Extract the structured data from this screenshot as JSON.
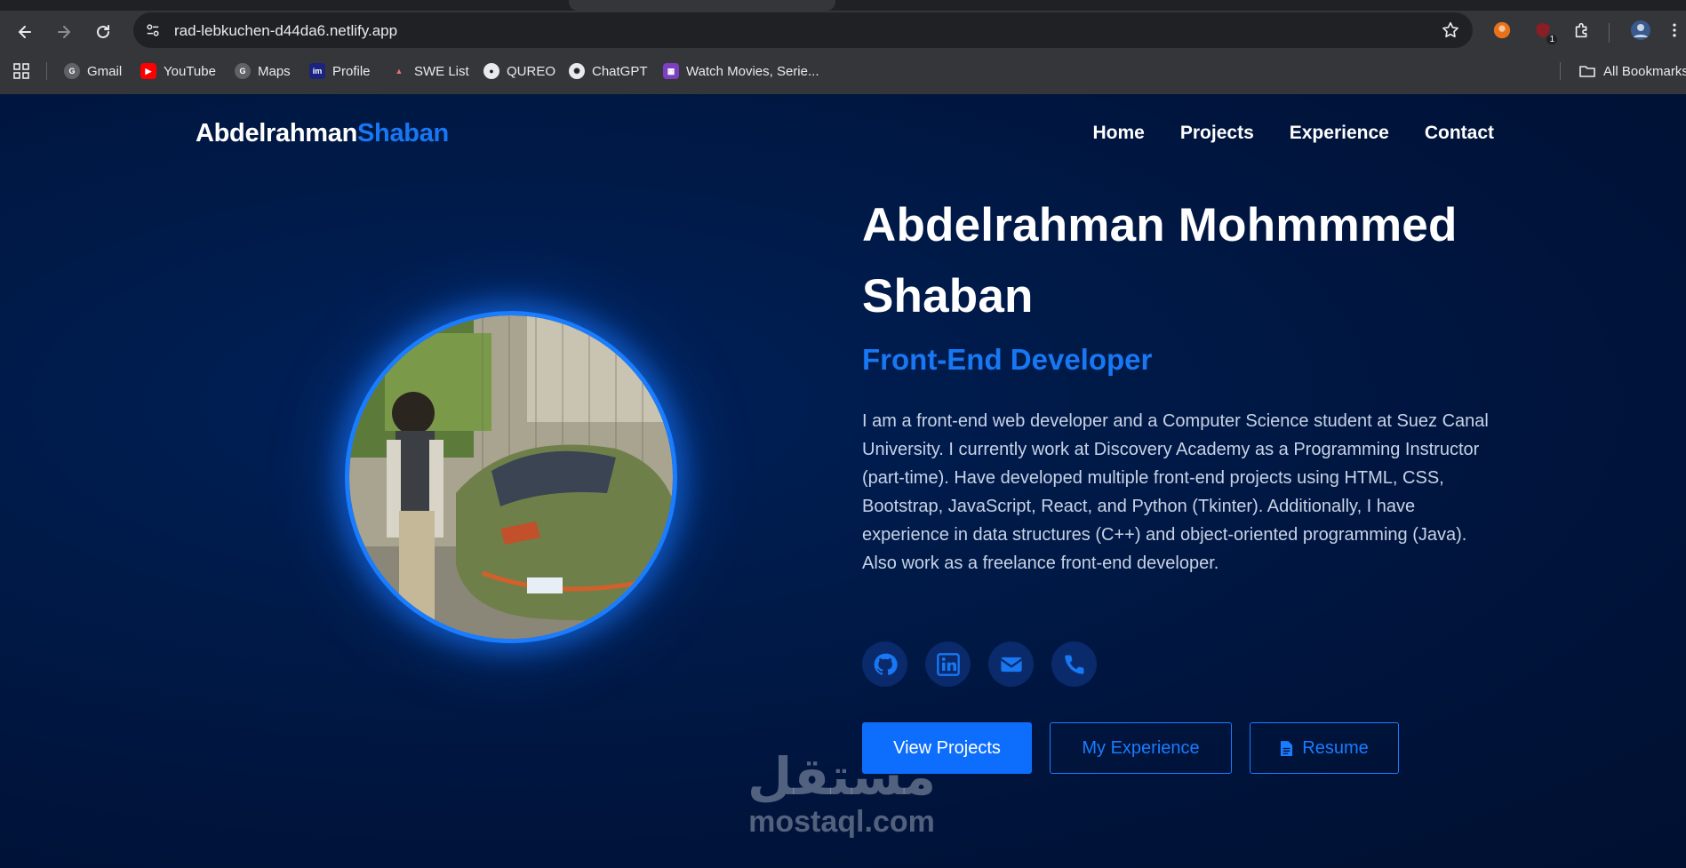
{
  "browser": {
    "url": "rad-lebkuchen-d44da6.netlify.app",
    "bookmarks": [
      {
        "label": "Gmail",
        "icon": "google-icon"
      },
      {
        "label": "YouTube",
        "icon": "youtube-icon"
      },
      {
        "label": "Maps",
        "icon": "google-icon"
      },
      {
        "label": "Profile",
        "icon": "profile-icon"
      },
      {
        "label": "SWE List",
        "icon": "rocket-icon"
      },
      {
        "label": "QUREO",
        "icon": "alien-icon"
      },
      {
        "label": "ChatGPT",
        "icon": "chatgpt-icon"
      },
      {
        "label": "Watch Movies, Serie...",
        "icon": "movie-icon"
      }
    ],
    "all_bookmarks": "All Bookmarks",
    "ext_badge": "1"
  },
  "site": {
    "brand_first": "Abdelrahman",
    "brand_second": "Shaban",
    "nav": [
      "Home",
      "Projects",
      "Experience",
      "Contact"
    ],
    "hero": {
      "name": "Abdelrahman Mohmmmed Shaban",
      "role": "Front-End Developer",
      "bio": "I am a front-end web developer and a Computer Science student at Suez Canal University. I currently work at Discovery Academy as a Programming Instructor (part-time). Have developed multiple front-end projects using HTML, CSS, Bootstrap, JavaScript, React, and Python (Tkinter). Additionally, I have experience in data structures (C++) and object-oriented programming (Java). Also work as a freelance front-end developer.",
      "socials": [
        "github-icon",
        "linkedin-icon",
        "envelope-icon",
        "phone-icon"
      ],
      "buttons": {
        "primary": "View Projects",
        "secondary": "My Experience",
        "resume": "Resume"
      }
    }
  },
  "watermark": {
    "arabic": "مستقل",
    "latin": "mostaql.com"
  },
  "colors": {
    "accent": "#1877f2",
    "page_bg": "#001233",
    "chrome": "#35363a"
  }
}
